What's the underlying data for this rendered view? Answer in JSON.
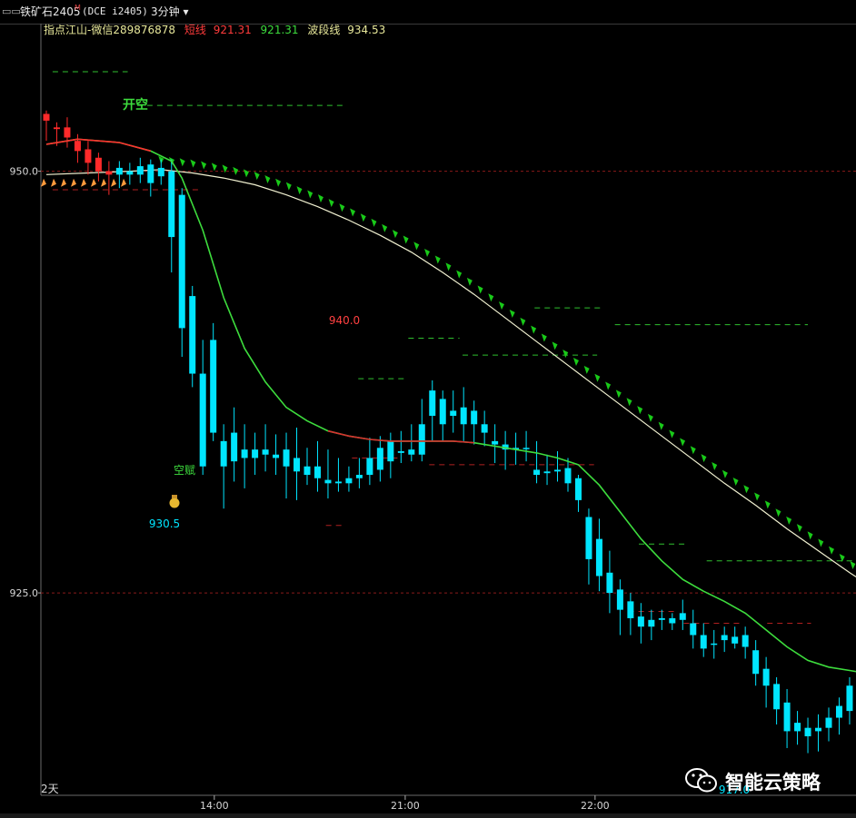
{
  "topbar": {
    "symbol": "铁矿石2405",
    "mark": "M",
    "exchange": "(DCE i2405)",
    "period": "3分钟",
    "period_caret": "▾"
  },
  "legend": {
    "indicator": "指点江山-微信289876878",
    "short_label": "短线",
    "short_value": "921.31",
    "mid_value": "921.31",
    "wave_label": "波段线",
    "wave_value": "934.53"
  },
  "colors": {
    "bull": "#00e5ff",
    "bear_early": "#ff2a2a",
    "short_line": "#3ddc3d",
    "wave_line": "#f0f0d0",
    "short_text": "#ff3b3b",
    "mid_text": "#3ddc3d",
    "wave_text": "#e8e89a",
    "arrow_green": "#19c919",
    "arrow_orange": "#ff9a3c",
    "grid_red": "#8a1a1a",
    "dash_green": "#2fbf2f",
    "dash_red": "#b02020"
  },
  "annotations": {
    "open_short": "开空",
    "short_sell": "空赋",
    "low_price": "930.5",
    "peak_price": "940.0",
    "bottom_price": "917.0",
    "days": "2天"
  },
  "watermark": {
    "text": "智能云策略",
    "icon": "wechat-icon"
  },
  "chart_data": {
    "type": "candlestick",
    "title": "",
    "ylim": [
      913.0,
      958.0
    ],
    "y_ticks": [
      950.0,
      925.0
    ],
    "x_ticks": [
      {
        "label": "14:00",
        "index": 16.1
      },
      {
        "label": "21:00",
        "index": 34.4
      },
      {
        "label": "22:00",
        "index": 52.6
      }
    ],
    "x_count": 72,
    "candles": [
      [
        953.0,
        953.4,
        951.8,
        953.6,
        1
      ],
      [
        952.6,
        952.5,
        951.5,
        952.9,
        1
      ],
      [
        952.6,
        952.0,
        951.4,
        953.2,
        1
      ],
      [
        951.8,
        951.2,
        950.5,
        952.2,
        1
      ],
      [
        951.3,
        950.5,
        949.8,
        951.8,
        1
      ],
      [
        950.8,
        950.0,
        949.4,
        951.1,
        1
      ],
      [
        950.0,
        949.8,
        948.6,
        950.6,
        1
      ],
      [
        949.8,
        950.2,
        949.0,
        950.6,
        0
      ],
      [
        950.0,
        949.8,
        949.2,
        950.5,
        0
      ],
      [
        950.3,
        949.8,
        949.3,
        950.8,
        0
      ],
      [
        950.4,
        949.3,
        948.5,
        950.7,
        0
      ],
      [
        949.7,
        950.2,
        949.2,
        950.7,
        0
      ],
      [
        950.0,
        946.1,
        944.0,
        950.7,
        0
      ],
      [
        948.6,
        940.7,
        939.0,
        949.0,
        0
      ],
      [
        942.6,
        938.0,
        937.2,
        943.2,
        0
      ],
      [
        938.0,
        932.5,
        932.0,
        940.0,
        0
      ],
      [
        940.0,
        934.5,
        934.0,
        941.0,
        0
      ],
      [
        934.0,
        932.5,
        930.0,
        935.0,
        0
      ],
      [
        932.8,
        934.5,
        931.6,
        936.0,
        0
      ],
      [
        933.0,
        933.5,
        931.2,
        935.0,
        0
      ],
      [
        933.0,
        933.5,
        932.0,
        934.5,
        0
      ],
      [
        933.5,
        933.2,
        932.2,
        935.0,
        0
      ],
      [
        933.0,
        933.2,
        932.0,
        934.4,
        0
      ],
      [
        933.5,
        932.5,
        930.6,
        934.5,
        0
      ],
      [
        933.0,
        932.2,
        930.5,
        934.8,
        0
      ],
      [
        932.5,
        932.0,
        931.4,
        933.6,
        0
      ],
      [
        932.5,
        931.8,
        931.0,
        934.0,
        0
      ],
      [
        931.7,
        931.5,
        930.6,
        933.5,
        0
      ],
      [
        931.6,
        931.5,
        931.0,
        933.0,
        0
      ],
      [
        931.5,
        931.8,
        931.0,
        932.5,
        0
      ],
      [
        931.8,
        932.0,
        931.2,
        933.0,
        0
      ],
      [
        932.0,
        933.0,
        931.4,
        934.2,
        0
      ],
      [
        932.3,
        933.6,
        931.6,
        934.3,
        0
      ],
      [
        932.8,
        934.0,
        931.8,
        934.5,
        0
      ],
      [
        933.3,
        933.4,
        932.7,
        934.6,
        0
      ],
      [
        933.2,
        933.5,
        932.8,
        935.0,
        0
      ],
      [
        933.2,
        935.0,
        932.8,
        936.5,
        0
      ],
      [
        935.5,
        937.0,
        934.0,
        937.6,
        0
      ],
      [
        935.0,
        936.5,
        934.0,
        937.0,
        0
      ],
      [
        935.8,
        935.5,
        934.5,
        937.0,
        0
      ],
      [
        936.0,
        935.0,
        934.0,
        937.2,
        0
      ],
      [
        935.8,
        935.0,
        933.8,
        936.4,
        0
      ],
      [
        935.0,
        934.5,
        933.7,
        935.8,
        0
      ],
      [
        934.0,
        933.8,
        932.7,
        935.0,
        0
      ],
      [
        933.8,
        933.5,
        932.3,
        934.6,
        0
      ],
      [
        933.5,
        933.6,
        932.6,
        934.5,
        0
      ],
      [
        933.6,
        933.6,
        932.8,
        934.6,
        0
      ],
      [
        932.3,
        932.0,
        931.5,
        934.0,
        0
      ],
      [
        932.2,
        932.1,
        931.4,
        933.2,
        0
      ],
      [
        932.2,
        932.3,
        931.6,
        933.4,
        0
      ],
      [
        932.4,
        931.5,
        931.0,
        933.0,
        0
      ],
      [
        931.8,
        930.5,
        929.8,
        932.0,
        0
      ],
      [
        929.5,
        927.0,
        925.5,
        930.0,
        0
      ],
      [
        928.2,
        926.0,
        925.1,
        929.4,
        0
      ],
      [
        926.2,
        925.0,
        923.8,
        927.5,
        0
      ],
      [
        925.2,
        924.0,
        922.5,
        925.8,
        0
      ],
      [
        924.5,
        923.5,
        922.5,
        925.0,
        0
      ],
      [
        923.6,
        923.0,
        922.0,
        924.4,
        0
      ],
      [
        923.0,
        923.4,
        922.2,
        924.0,
        0
      ],
      [
        923.4,
        923.5,
        922.8,
        924.0,
        0
      ],
      [
        923.5,
        923.2,
        922.8,
        923.8,
        0
      ],
      [
        923.4,
        923.8,
        922.8,
        924.6,
        0
      ],
      [
        923.2,
        922.5,
        921.7,
        924.0,
        0
      ],
      [
        922.5,
        921.7,
        921.2,
        923.2,
        0
      ],
      [
        922.0,
        922.0,
        921.1,
        922.8,
        0
      ],
      [
        922.2,
        922.5,
        921.5,
        923.0,
        0
      ],
      [
        922.0,
        922.4,
        921.7,
        923.0,
        0
      ],
      [
        922.5,
        921.8,
        921.1,
        923.0,
        0
      ],
      [
        921.6,
        920.2,
        919.5,
        922.2,
        0
      ],
      [
        920.5,
        919.5,
        918.2,
        921.2,
        0
      ],
      [
        919.6,
        918.1,
        917.2,
        920.0,
        0
      ],
      [
        918.5,
        916.8,
        915.8,
        919.3,
        0
      ],
      [
        917.3,
        916.8,
        916.0,
        918.0,
        0
      ],
      [
        917.0,
        916.5,
        915.5,
        917.6,
        0
      ],
      [
        916.8,
        917.0,
        915.6,
        917.8,
        0
      ],
      [
        917.0,
        917.6,
        916.2,
        918.2,
        0
      ],
      [
        917.6,
        918.3,
        916.6,
        918.8,
        0
      ],
      [
        918.0,
        919.5,
        917.2,
        920.0,
        0
      ],
      [
        919.5,
        920.3,
        918.5,
        920.6,
        0
      ],
      [
        920.3,
        920.2,
        919.5,
        920.8,
        0
      ],
      [
        920.3,
        920.5,
        919.3,
        921.0,
        0
      ]
    ],
    "short_line": [
      [
        0,
        951.6
      ],
      [
        3,
        951.9
      ],
      [
        7,
        951.7
      ],
      [
        10,
        951.2
      ],
      [
        12,
        950.6
      ],
      [
        13,
        949.6
      ],
      [
        15,
        946.5
      ],
      [
        17,
        942.5
      ],
      [
        19,
        939.5
      ],
      [
        21,
        937.5
      ],
      [
        23,
        936.0
      ],
      [
        25,
        935.2
      ],
      [
        27,
        934.6
      ],
      [
        29,
        934.3
      ],
      [
        31,
        934.1
      ],
      [
        33,
        934.0
      ],
      [
        35,
        934.0
      ],
      [
        37,
        934.0
      ],
      [
        39,
        934.0
      ],
      [
        41,
        933.9
      ],
      [
        43,
        933.7
      ],
      [
        45,
        933.5
      ],
      [
        47,
        933.3
      ],
      [
        49,
        933.0
      ],
      [
        51,
        932.6
      ],
      [
        53,
        931.4
      ],
      [
        55,
        929.8
      ],
      [
        57,
        928.2
      ],
      [
        59,
        926.9
      ],
      [
        61,
        925.8
      ],
      [
        63,
        925.1
      ],
      [
        65,
        924.5
      ],
      [
        67,
        923.8
      ],
      [
        69,
        922.8
      ],
      [
        71,
        921.8
      ],
      [
        73,
        921.0
      ],
      [
        75,
        920.6
      ],
      [
        77,
        920.4
      ],
      [
        79,
        920.2
      ],
      [
        80,
        920.0
      ]
    ],
    "wave_line": [
      [
        0,
        949.8
      ],
      [
        4,
        949.9
      ],
      [
        8,
        950.0
      ],
      [
        11,
        950.1
      ],
      [
        14,
        949.9
      ],
      [
        17,
        949.6
      ],
      [
        20,
        949.2
      ],
      [
        23,
        948.6
      ],
      [
        26,
        947.9
      ],
      [
        29,
        947.1
      ],
      [
        32,
        946.2
      ],
      [
        35,
        945.2
      ],
      [
        38,
        944.0
      ],
      [
        41,
        942.7
      ],
      [
        44,
        941.3
      ],
      [
        47,
        939.9
      ],
      [
        50,
        938.5
      ],
      [
        53,
        937.1
      ],
      [
        56,
        935.7
      ],
      [
        59,
        934.3
      ],
      [
        62,
        932.9
      ],
      [
        65,
        931.5
      ],
      [
        68,
        930.2
      ],
      [
        71,
        928.8
      ],
      [
        74,
        927.5
      ],
      [
        77,
        926.2
      ],
      [
        80,
        925.0
      ]
    ],
    "levels": [
      {
        "value": 950.0,
        "style": "grid"
      },
      {
        "value": 925.0,
        "style": "grid"
      }
    ],
    "dashes_green": [
      [
        0.6,
        7.8,
        955.9
      ],
      [
        8.7,
        28.4,
        953.9
      ],
      [
        46.8,
        53.4,
        941.9
      ],
      [
        54.5,
        73.0,
        940.9
      ],
      [
        34.7,
        39.6,
        940.1
      ],
      [
        39.9,
        52.8,
        939.1
      ],
      [
        29.9,
        34.3,
        937.7
      ],
      [
        56.8,
        61.2,
        927.9
      ],
      [
        63.3,
        77.6,
        926.9
      ]
    ],
    "dashes_red": [
      [
        0.6,
        14.6,
        948.9
      ],
      [
        29.3,
        34.0,
        933.0
      ],
      [
        36.7,
        52.5,
        932.6
      ],
      [
        26.8,
        28.4,
        929.0
      ],
      [
        55.8,
        60.3,
        923.9
      ],
      [
        61.1,
        66.6,
        923.2
      ],
      [
        69.1,
        73.3,
        923.2
      ]
    ]
  }
}
